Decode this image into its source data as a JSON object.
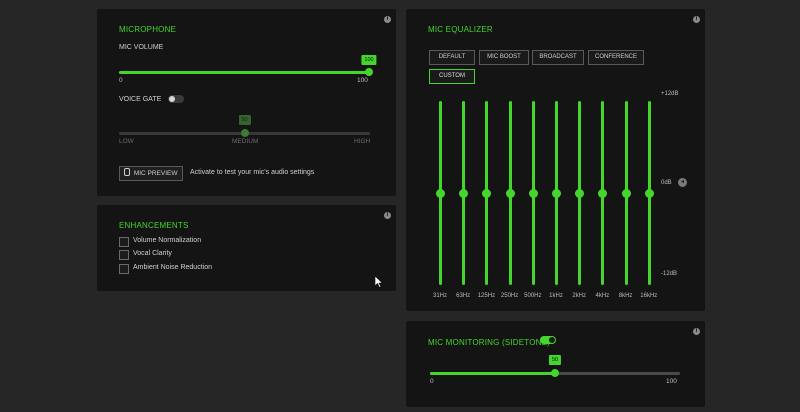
{
  "microphone": {
    "title": "MICROPHONE",
    "volume_label": "MIC VOLUME",
    "volume_value": "100",
    "volume_percent": 100,
    "volume_min": "0",
    "volume_max": "100",
    "voice_gate_label": "VOICE GATE",
    "voice_gate_on": false,
    "gate_value": "50",
    "gate_percent": 50,
    "gate_low": "LOW",
    "gate_medium": "MEDIUM",
    "gate_high": "HIGH",
    "preview_button": "MIC PREVIEW",
    "preview_hint": "Activate to test your mic's audio settings"
  },
  "enhancements": {
    "title": "ENHANCEMENTS",
    "options": [
      {
        "label": "Volume Normalization",
        "checked": false
      },
      {
        "label": "Vocal Clarity",
        "checked": false
      },
      {
        "label": "Ambient Noise Reduction",
        "checked": false
      }
    ]
  },
  "equalizer": {
    "title": "MIC EQUALIZER",
    "presets": [
      "DEFAULT",
      "MIC BOOST",
      "BROADCAST",
      "CONFERENCE",
      "CUSTOM"
    ],
    "active_preset": "CUSTOM",
    "db_top": "+12dB",
    "db_mid": "0dB",
    "db_bottom": "-12dB",
    "bands": [
      {
        "label": "31Hz",
        "gain_db": 0
      },
      {
        "label": "63Hz",
        "gain_db": 0
      },
      {
        "label": "125Hz",
        "gain_db": 0
      },
      {
        "label": "250Hz",
        "gain_db": 0
      },
      {
        "label": "500Hz",
        "gain_db": 0
      },
      {
        "label": "1kHz",
        "gain_db": 0
      },
      {
        "label": "2kHz",
        "gain_db": 0
      },
      {
        "label": "4kHz",
        "gain_db": 0
      },
      {
        "label": "8kHz",
        "gain_db": 0
      },
      {
        "label": "16kHz",
        "gain_db": 0
      }
    ]
  },
  "monitoring": {
    "title": "MIC MONITORING (SIDETONE)",
    "enabled": true,
    "value": "50",
    "percent": 50,
    "min": "0",
    "max": "100"
  },
  "colors": {
    "accent": "#44d62c",
    "panel": "#141414",
    "background": "#262626"
  },
  "icons": [
    "info-icon",
    "microphone-icon",
    "reset-icon",
    "mouse-cursor-icon"
  ]
}
